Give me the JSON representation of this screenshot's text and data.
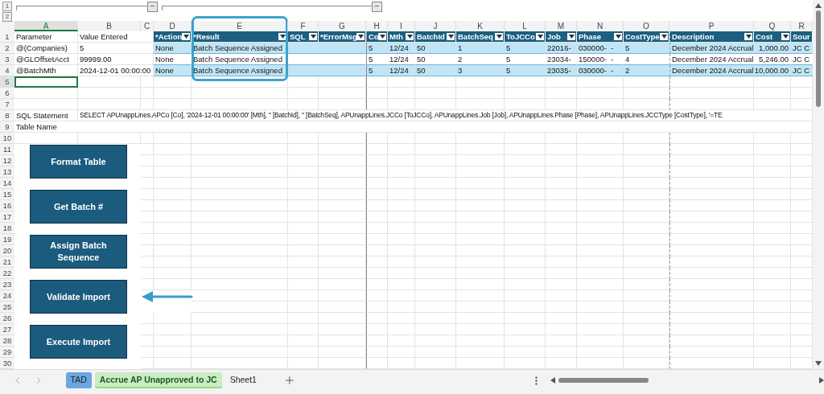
{
  "outline": {
    "levels": [
      {
        "label": "1"
      },
      {
        "label": "2"
      }
    ],
    "groups": [
      {
        "collapse": "−"
      },
      {
        "collapse": "−"
      }
    ]
  },
  "columns": [
    {
      "label": "A",
      "selected": true,
      "table": false
    },
    {
      "label": "B",
      "selected": false,
      "table": false
    },
    {
      "label": "C",
      "selected": false,
      "table": false
    },
    {
      "label": "D",
      "selected": false,
      "table": true
    },
    {
      "label": "E",
      "selected": false,
      "table": true,
      "highlighted": true
    },
    {
      "label": "F",
      "selected": false,
      "table": true
    },
    {
      "label": "G",
      "selected": false,
      "table": true
    },
    {
      "label": "H",
      "selected": false,
      "table": true
    },
    {
      "label": "I",
      "selected": false,
      "table": true
    },
    {
      "label": "J",
      "selected": false,
      "table": true
    },
    {
      "label": "K",
      "selected": false,
      "table": true
    },
    {
      "label": "L",
      "selected": false,
      "table": true
    },
    {
      "label": "M",
      "selected": false,
      "table": true
    },
    {
      "label": "N",
      "selected": false,
      "table": true
    },
    {
      "label": "O",
      "selected": false,
      "table": true
    },
    {
      "label": "P",
      "selected": false,
      "table": true
    },
    {
      "label": "Q",
      "selected": false,
      "table": true
    },
    {
      "label": "R",
      "selected": false,
      "table": true
    }
  ],
  "rows": [
    {
      "number": "1",
      "selected": false,
      "kind": "table-header",
      "cells": {
        "A": "Parameter",
        "B": "Value Entered",
        "D": "*Action",
        "E": "*Result",
        "F": "SQL",
        "G": "*ErrorMsg",
        "H": "Co",
        "I": "Mth",
        "J": "BatchId",
        "K": "BatchSeq",
        "L": "ToJCCo",
        "M": "Job",
        "N": "Phase",
        "O": "CostType",
        "P": "Description",
        "Q": "Cost",
        "R": "Sour"
      }
    },
    {
      "number": "2",
      "selected": false,
      "kind": "table-data",
      "banded": true,
      "cells": {
        "A": "@(Companies)",
        "B": "5",
        "D": "None",
        "E": "Batch Sequence Assigned",
        "H": "5",
        "I": "12/24",
        "J": "50",
        "K": "1",
        "L": "5",
        "M": "22016-",
        "N": "030000-  -",
        "O": "5",
        "P": "December 2024 Accrual",
        "Q": "1,000.00",
        "R": "JC C"
      }
    },
    {
      "number": "3",
      "selected": false,
      "kind": "table-data",
      "banded": false,
      "cells": {
        "A": "@GLOffsetAcct",
        "B": "99999.00",
        "D": "None",
        "E": "Batch Sequence Assigned",
        "H": "5",
        "I": "12/24",
        "J": "50",
        "K": "2",
        "L": "5",
        "M": "23034-",
        "N": "150000-  -",
        "O": "4",
        "P": "December 2024 Accrual",
        "Q": "5,246.00",
        "R": "JC C"
      }
    },
    {
      "number": "4",
      "selected": false,
      "kind": "table-data",
      "banded": true,
      "cells": {
        "A": "@BatchMth",
        "B": "2024-12-01 00:00:00",
        "D": "None",
        "E": "Batch Sequence Assigned",
        "H": "5",
        "I": "12/24",
        "J": "50",
        "K": "3",
        "L": "5",
        "M": "23035-",
        "N": "030000-  -",
        "O": "2",
        "P": "December 2024 Accrual",
        "Q": "10,000.00",
        "R": "JC C"
      }
    },
    {
      "number": "5",
      "selected": true,
      "kind": "plain"
    },
    {
      "number": "6",
      "selected": false,
      "kind": "plain"
    },
    {
      "number": "7",
      "selected": false,
      "kind": "plain"
    },
    {
      "number": "8",
      "selected": false,
      "kind": "plain",
      "cells": {
        "A": "SQL Statement",
        "B": "SELECT APUnappLines.APCo [Co], '2024-12-01 00:00:00' [Mth], '' [BatchId], '' [BatchSeq], APUnappLines.JCCo [ToJCCo], APUnappLines.Job [Job], APUnappLines.Phase [Phase], APUnappLines.JCCType [CostType], '=TE"
      }
    },
    {
      "number": "9",
      "selected": false,
      "kind": "plain",
      "cells": {
        "A": "Table Name"
      }
    },
    {
      "number": "10",
      "selected": false,
      "kind": "plain"
    },
    {
      "number": "11",
      "selected": false,
      "kind": "plain"
    },
    {
      "number": "12",
      "selected": false,
      "kind": "plain"
    },
    {
      "number": "13",
      "selected": false,
      "kind": "plain"
    },
    {
      "number": "14",
      "selected": false,
      "kind": "plain"
    },
    {
      "number": "15",
      "selected": false,
      "kind": "plain"
    },
    {
      "number": "16",
      "selected": false,
      "kind": "plain"
    },
    {
      "number": "17",
      "selected": false,
      "kind": "plain"
    },
    {
      "number": "18",
      "selected": false,
      "kind": "plain"
    },
    {
      "number": "19",
      "selected": false,
      "kind": "plain"
    },
    {
      "number": "20",
      "selected": false,
      "kind": "plain"
    },
    {
      "number": "21",
      "selected": false,
      "kind": "plain"
    },
    {
      "number": "22",
      "selected": false,
      "kind": "plain"
    },
    {
      "number": "23",
      "selected": false,
      "kind": "plain"
    },
    {
      "number": "24",
      "selected": false,
      "kind": "plain"
    },
    {
      "number": "25",
      "selected": false,
      "kind": "plain"
    },
    {
      "number": "26",
      "selected": false,
      "kind": "plain"
    },
    {
      "number": "27",
      "selected": false,
      "kind": "plain"
    },
    {
      "number": "28",
      "selected": false,
      "kind": "plain"
    },
    {
      "number": "29",
      "selected": false,
      "kind": "plain"
    },
    {
      "number": "30",
      "selected": false,
      "kind": "plain"
    }
  ],
  "macro_buttons": [
    {
      "label": "Format Table",
      "arrow": false
    },
    {
      "label": "Get Batch #",
      "arrow": false
    },
    {
      "label": "Assign Batch Sequence",
      "arrow": false
    },
    {
      "label": "Validate Import",
      "arrow": true
    },
    {
      "label": "Execute Import",
      "arrow": false
    }
  ],
  "sheet_tabs": [
    {
      "label": "TAD",
      "selected": false,
      "color": "#6aa6e0"
    },
    {
      "label": "Accrue AP Unapproved to JC",
      "selected": true,
      "color": "#8fe07c"
    },
    {
      "label": "Sheet1",
      "selected": false
    }
  ]
}
